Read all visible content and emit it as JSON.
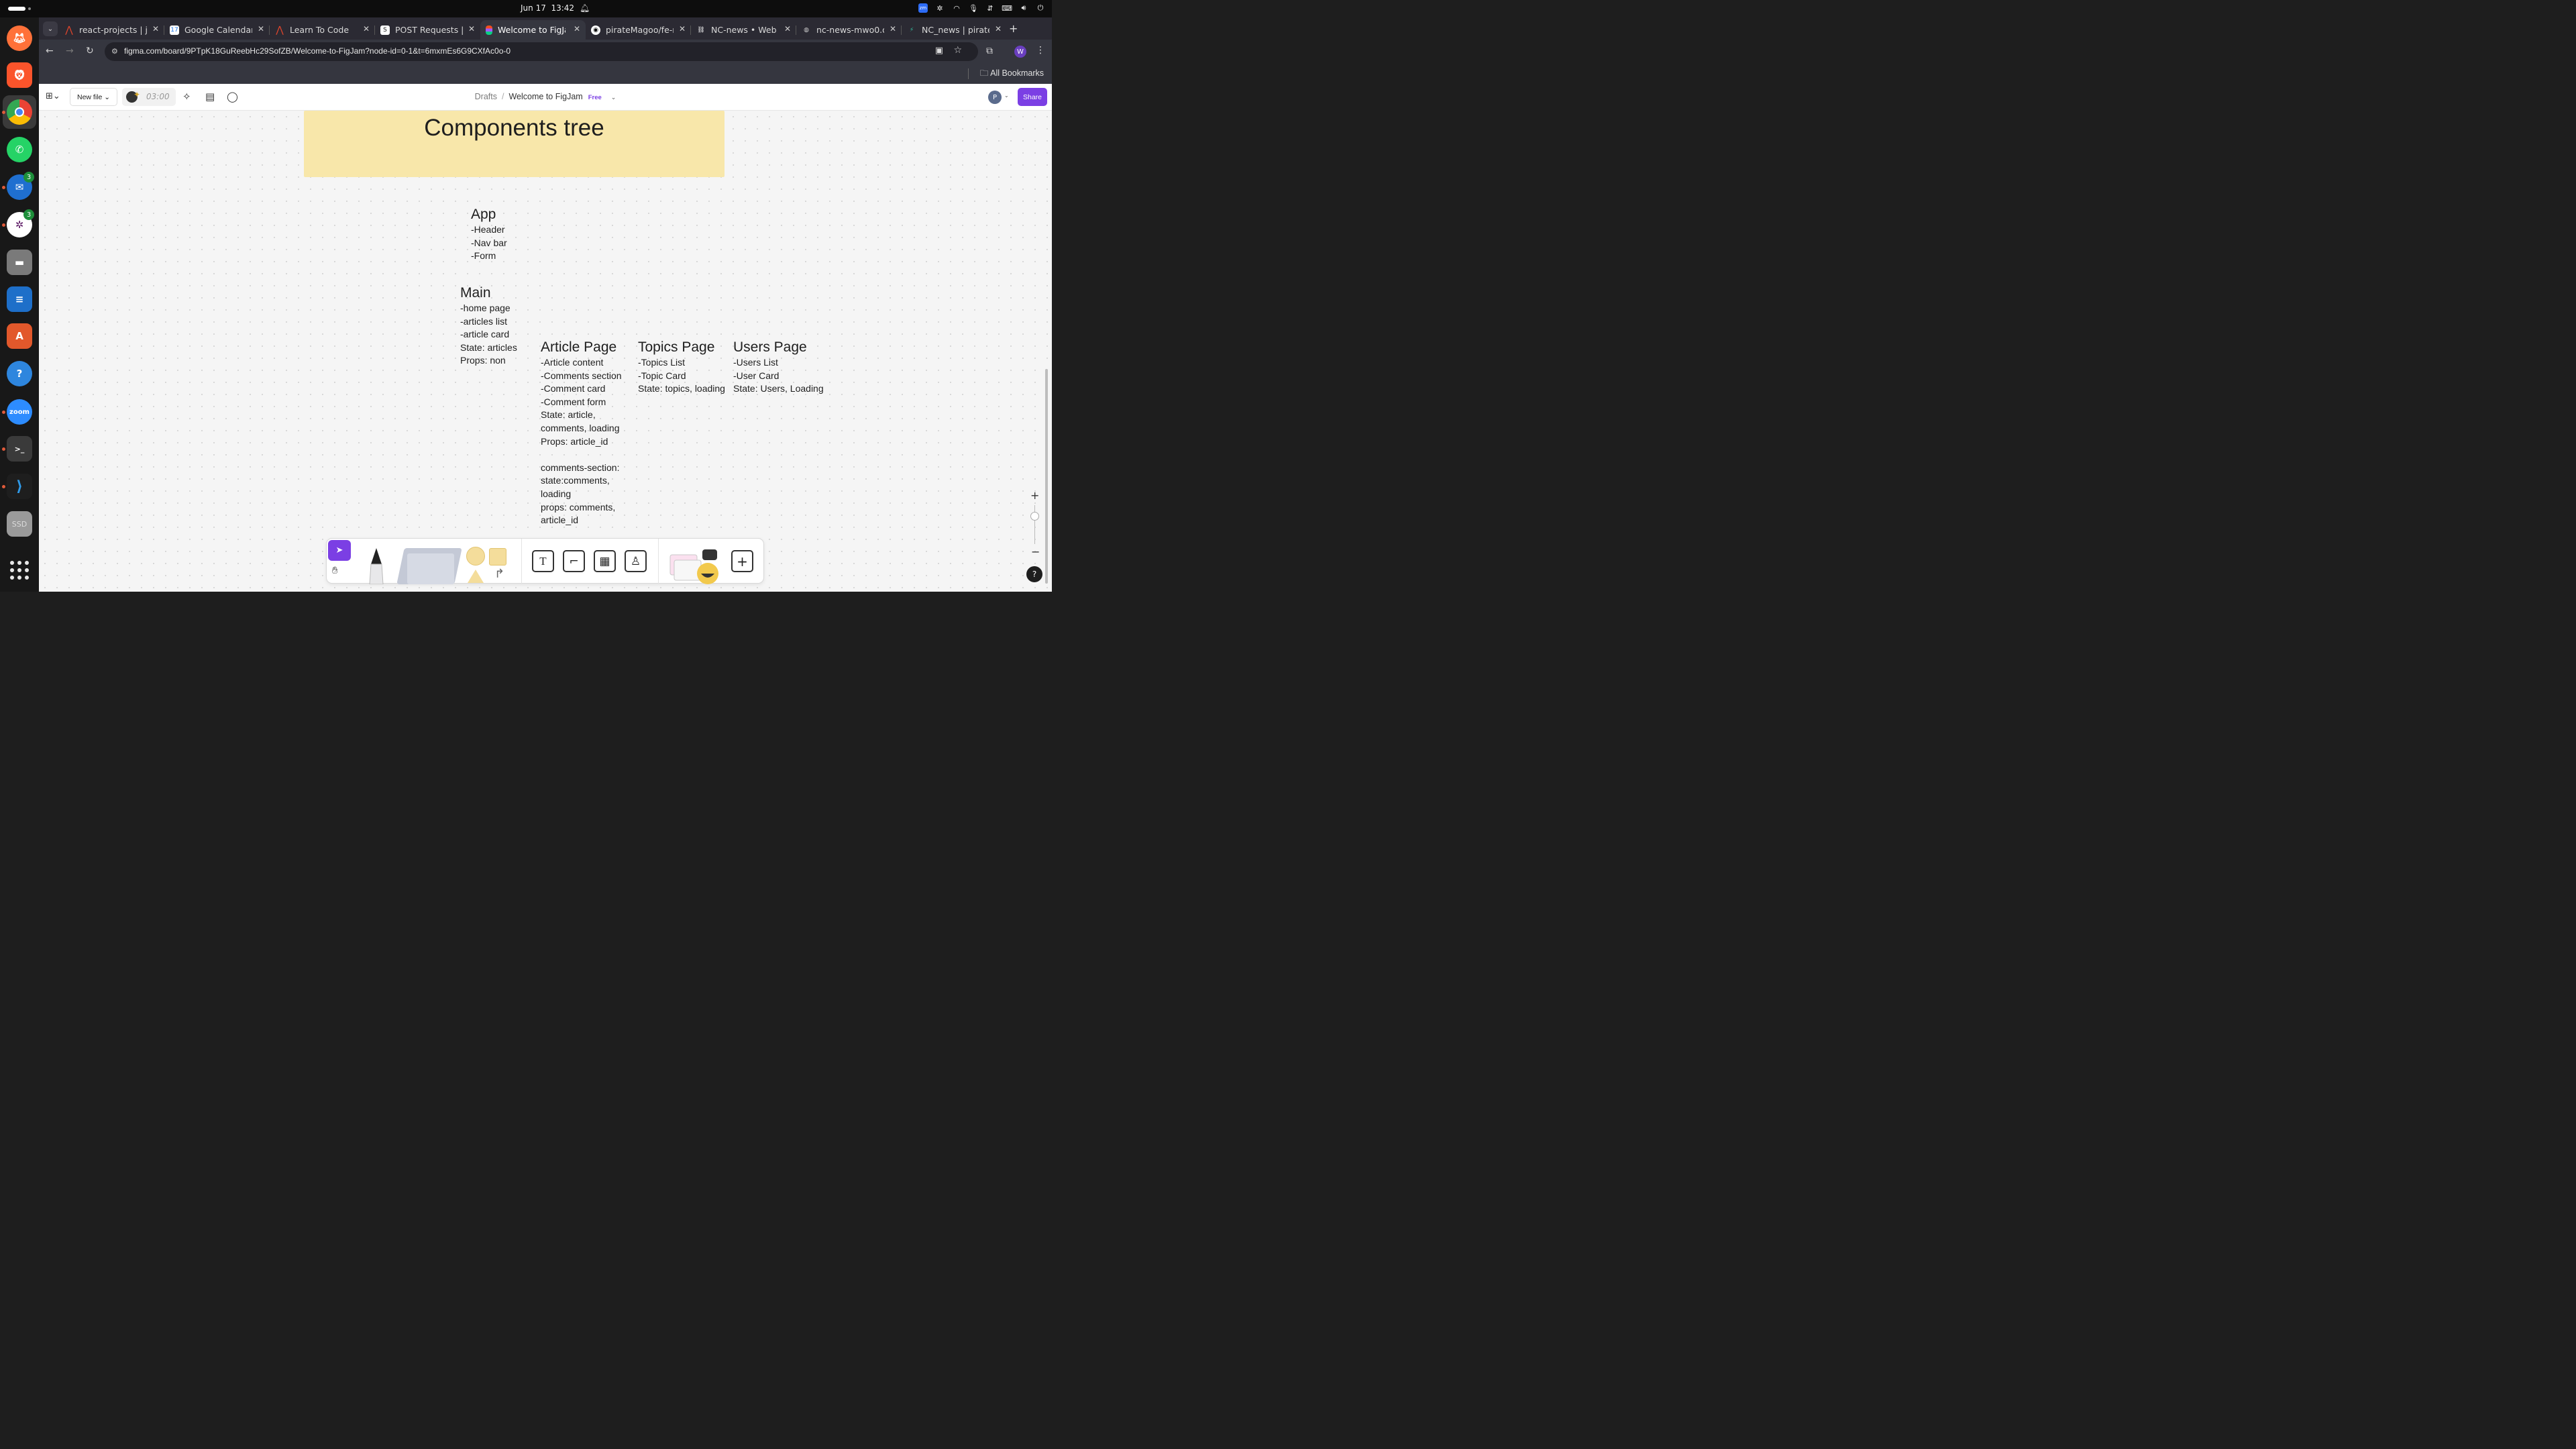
{
  "system": {
    "date": "Jun 17",
    "time": "13:42"
  },
  "dock": {
    "badges": [
      "3",
      "3"
    ],
    "ssd_label": "SSD",
    "zoom_label": "zoom"
  },
  "browser": {
    "tabs": [
      {
        "title": "react-projects | js"
      },
      {
        "title": "Google Calendar -"
      },
      {
        "title": "Learn To Code"
      },
      {
        "title": "POST Requests | A"
      },
      {
        "title": "Welcome to FigJa"
      },
      {
        "title": "pirateMagoo/fe-n"
      },
      {
        "title": "NC-news • Web S"
      },
      {
        "title": "nc-news-mwo0.on"
      },
      {
        "title": "NC_news | pirateM"
      }
    ],
    "url": "figma.com/board/9PTpK18GuReebHc29SofZB/Welcome-to-FigJam?node-id=0-1&t=6mxmEs6G9CXfAc0o-0",
    "profile_initial": "W",
    "bookmarks_label": "All Bookmarks"
  },
  "figjam": {
    "new_file_label": "New file",
    "timer": "03:00",
    "breadcrumb": {
      "drafts": "Drafts",
      "file_name": "Welcome to FigJam",
      "plan": "Free"
    },
    "avatar_initial": "P",
    "share_label": "Share"
  },
  "board": {
    "sticky_title": "Components tree",
    "app": {
      "title": "App",
      "lines": [
        "-Header",
        "-Nav bar",
        "-Form"
      ]
    },
    "main": {
      "title": "Main",
      "lines": [
        "-home page",
        "-articles list",
        "-article card",
        "State: articles",
        "Props: non"
      ]
    },
    "article_page": {
      "title": "Article Page",
      "lines": [
        "-Article content",
        "-Comments section",
        "-Comment card",
        "-Comment form",
        "State: article,",
        "comments, loading",
        "Props: article_id"
      ],
      "lines2": [
        "comments-section:",
        "state:comments,",
        "loading",
        "props: comments,",
        "article_id"
      ]
    },
    "topics_page": {
      "title": "Topics Page",
      "lines": [
        "-Topics List",
        "-Topic Card",
        "State: topics, loading"
      ]
    },
    "users_page": {
      "title": "Users Page",
      "lines": [
        "-Users List",
        "-User Card",
        "State: Users, Loading"
      ]
    }
  },
  "controls": {
    "help_label": "?"
  }
}
